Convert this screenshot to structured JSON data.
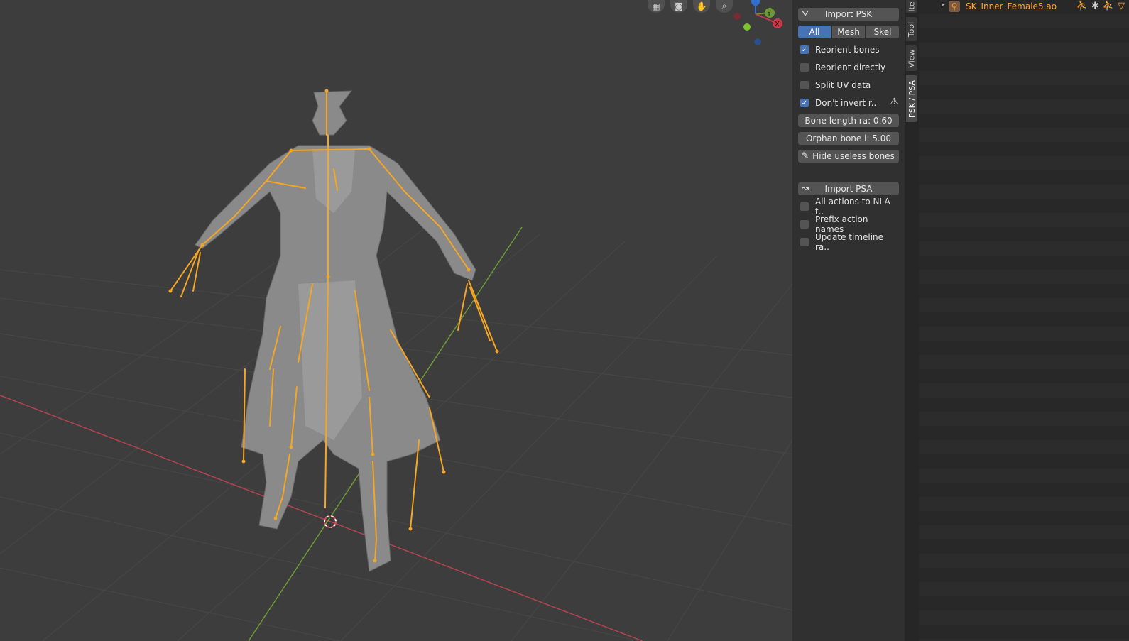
{
  "viewport": {
    "nav_icons": [
      "grid-icon",
      "camera-icon",
      "hand-icon",
      "zoom-icon"
    ],
    "gizmo": {
      "y_label": "Y",
      "x_label": "X"
    }
  },
  "npanel": {
    "import_psk_label": "Import PSK",
    "filter_options": [
      "All",
      "Mesh",
      "Skel"
    ],
    "filter_selected": "All",
    "checkboxes_psk": [
      {
        "label": "Reorient bones",
        "checked": true
      },
      {
        "label": "Reorient directly",
        "checked": false
      },
      {
        "label": "Split UV data",
        "checked": false
      },
      {
        "label": "Don't invert r..",
        "checked": true
      }
    ],
    "bone_length_label": "Bone length ra: 0.60",
    "orphan_bone_label": "Orphan bone l:  5.00",
    "hide_useless_label": "Hide useless bones",
    "import_psa_label": "Import PSA",
    "checkboxes_psa": [
      {
        "label": "All actions to NLA t..",
        "checked": false
      },
      {
        "label": "Prefix action names",
        "checked": false
      },
      {
        "label": "Update timeline ra..",
        "checked": false
      }
    ]
  },
  "tabs": [
    "Ite",
    "Tool",
    "View",
    "PSK / PSA"
  ],
  "active_tab": "PSK / PSA",
  "outliner": {
    "item_label": "SK_Inner_Female5.ao"
  },
  "colors": {
    "accent": "#4772b3",
    "bone": "#f5a623",
    "outliner_text": "#ff9f2e"
  }
}
